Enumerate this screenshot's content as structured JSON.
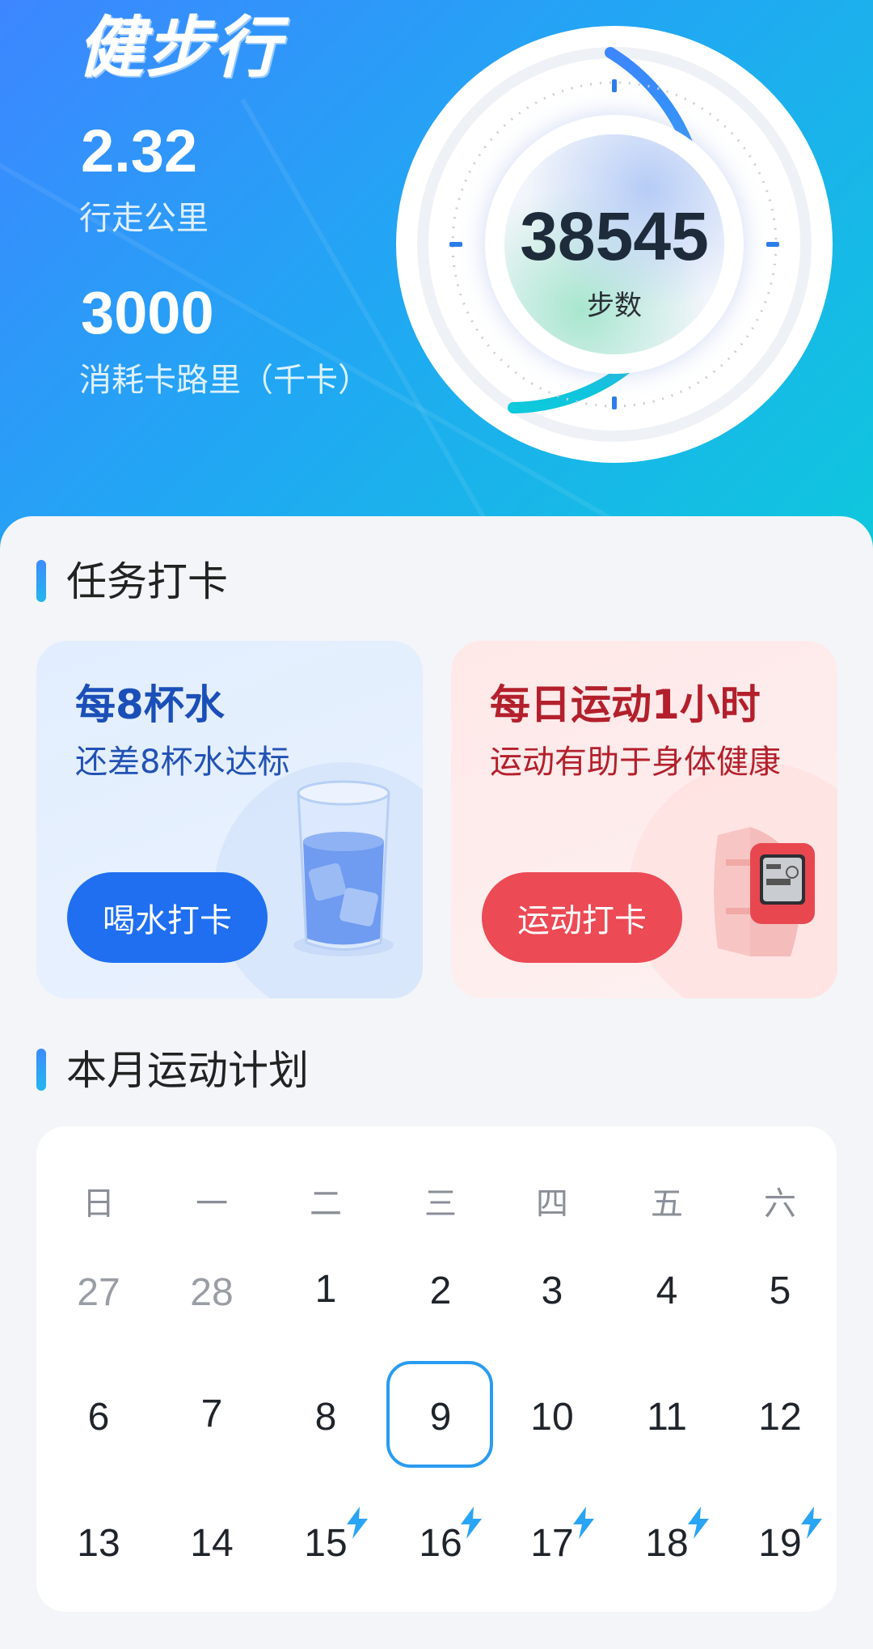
{
  "header": {
    "app_title": "健步行",
    "distance": {
      "value": "2.32",
      "label": "行走公里"
    },
    "calories": {
      "value": "3000",
      "label": "消耗卡路里（千卡）"
    },
    "steps": {
      "value": "38545",
      "label": "步数"
    }
  },
  "tasks": {
    "section_title": "任务打卡",
    "water": {
      "title": "每8杯水",
      "subtitle": "还差8杯水达标",
      "button": "喝水打卡",
      "icon": "water-glass-icon"
    },
    "sport": {
      "title": "每日运动1小时",
      "subtitle": "运动有助于身体健康",
      "button": "运动打卡",
      "icon": "smartwatch-icon"
    }
  },
  "calendar": {
    "section_title": "本月运动计划",
    "weekdays": [
      "日",
      "一",
      "二",
      "三",
      "四",
      "五",
      "六"
    ],
    "rows": [
      [
        "27",
        "28",
        "1",
        "2",
        "3",
        "4",
        "5"
      ],
      [
        "6",
        "7",
        "8",
        "9",
        "10",
        "11",
        "12"
      ],
      [
        "13",
        "14",
        "15",
        "16",
        "17",
        "18",
        "19"
      ]
    ],
    "selected_day": "9",
    "bolt_days": [
      "15",
      "16",
      "17",
      "18",
      "19"
    ]
  },
  "colors": {
    "header_gradient_start": "#3d86ff",
    "header_gradient_end": "#0ec8dc",
    "water_button": "#1f6ff0",
    "sport_button": "#ec4a55",
    "selected_day_border": "#2a9bf0"
  }
}
